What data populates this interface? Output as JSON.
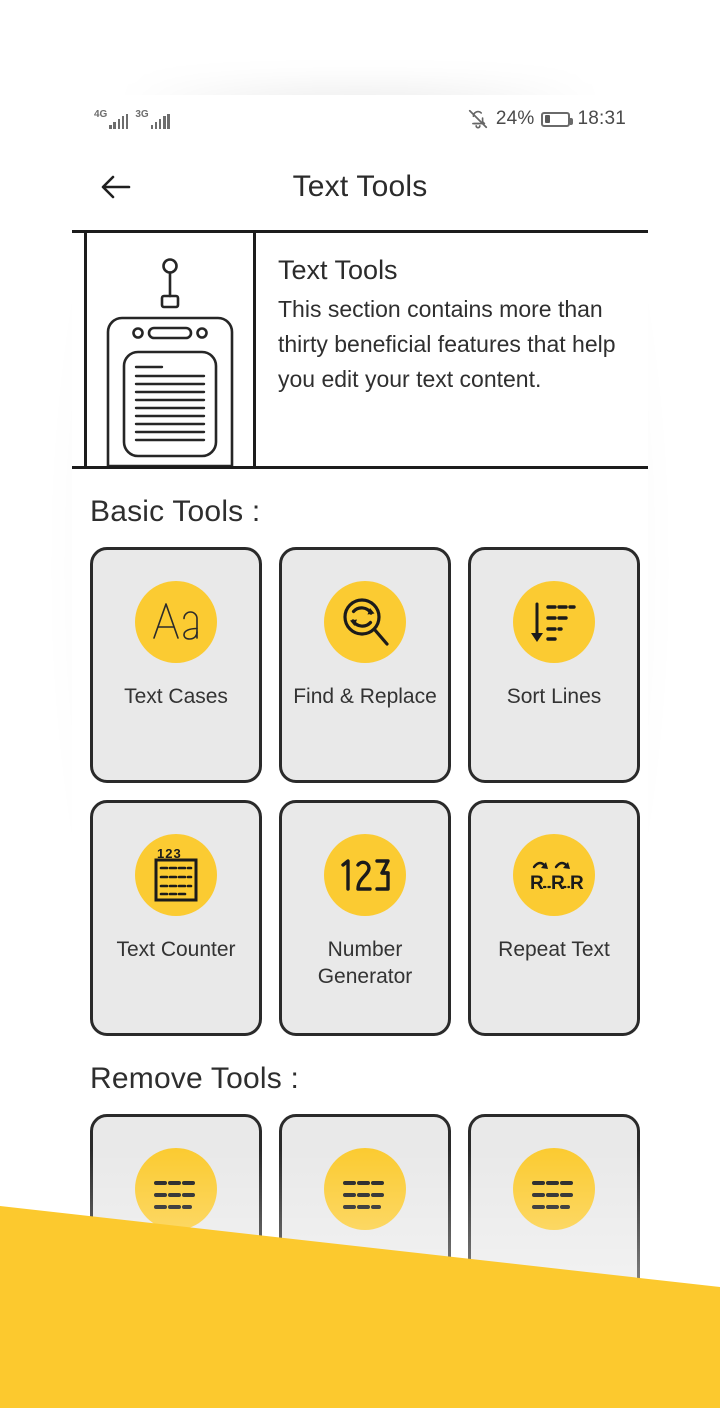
{
  "status_bar": {
    "networks": [
      {
        "label": "4G",
        "icon": "signal-bars-icon"
      },
      {
        "label": "3G",
        "icon": "signal-bars-icon"
      }
    ],
    "mute_icon": "bell-muted-icon",
    "battery_percent": "24%",
    "battery_level": 24,
    "time": "18:31"
  },
  "app_bar": {
    "back_icon": "arrow-left-icon",
    "title": "Text Tools"
  },
  "banner": {
    "illustration": "radio-document-icon",
    "title": "Text Tools",
    "description": "This section contains more than thirty beneficial features that help you edit your text content."
  },
  "sections": [
    {
      "title": "Basic Tools :",
      "cards": [
        {
          "label": "Text Cases",
          "icon": "text-cases-aa-icon"
        },
        {
          "label": "Find & Replace",
          "icon": "find-replace-magnifier-icon"
        },
        {
          "label": "Sort Lines",
          "icon": "sort-lines-down-arrow-icon"
        },
        {
          "label": "Text Counter",
          "icon": "text-counter-document-icon"
        },
        {
          "label": "Number Generator",
          "icon": "number-123-icon"
        },
        {
          "label": "Repeat Text",
          "icon": "repeat-text-rrr-icon"
        }
      ]
    },
    {
      "title": "Remove Tools :",
      "cards": [
        {
          "label": "",
          "icon": "remove-lines-icon"
        },
        {
          "label": "",
          "icon": "remove-lines-icon"
        },
        {
          "label": "",
          "icon": "remove-lines-icon"
        }
      ]
    }
  ],
  "colors": {
    "accent_yellow": "#FBCB32",
    "card_gray": "#E9E9E9",
    "border_dark": "#2A2A2A",
    "text_dark": "#2B2B2B",
    "overlay_yellow": "#FCC92E"
  }
}
